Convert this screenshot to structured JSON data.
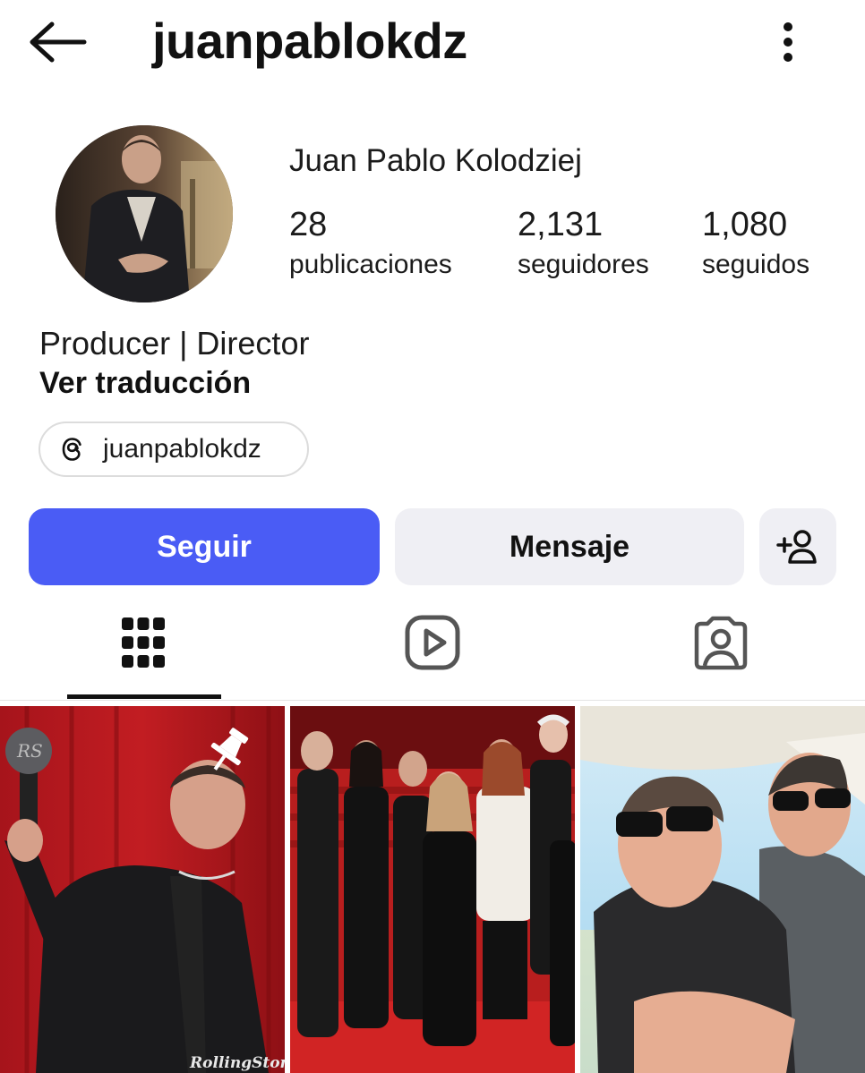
{
  "header": {
    "username": "juanpablokdz",
    "back_icon": "arrow-left-icon",
    "more_icon": "vertical-dots-icon"
  },
  "profile": {
    "full_name": "Juan Pablo Kolodziej",
    "stats": [
      {
        "value": "28",
        "label": "publicaciones"
      },
      {
        "value": "2,131",
        "label": "seguidores"
      },
      {
        "value": "1,080",
        "label": "seguidos"
      }
    ],
    "bio": "Producer | Director",
    "translate_label": "Ver traducción",
    "threads_handle": "juanpablokdz"
  },
  "actions": {
    "follow_label": "Seguir",
    "message_label": "Mensaje",
    "suggest_icon": "add-person-icon"
  },
  "tabs": [
    {
      "name": "posts",
      "icon": "grid-icon",
      "active": true
    },
    {
      "name": "reels",
      "icon": "reels-icon",
      "active": false
    },
    {
      "name": "tagged",
      "icon": "tagged-person-icon",
      "active": false
    }
  ],
  "posts": [
    {
      "pinned": true,
      "watermark": "RollingStone"
    },
    {
      "pinned": false
    },
    {
      "pinned": false
    }
  ],
  "colors": {
    "accent": "#4a5cf5",
    "secondary_button": "#efeff4",
    "text": "#111111"
  }
}
